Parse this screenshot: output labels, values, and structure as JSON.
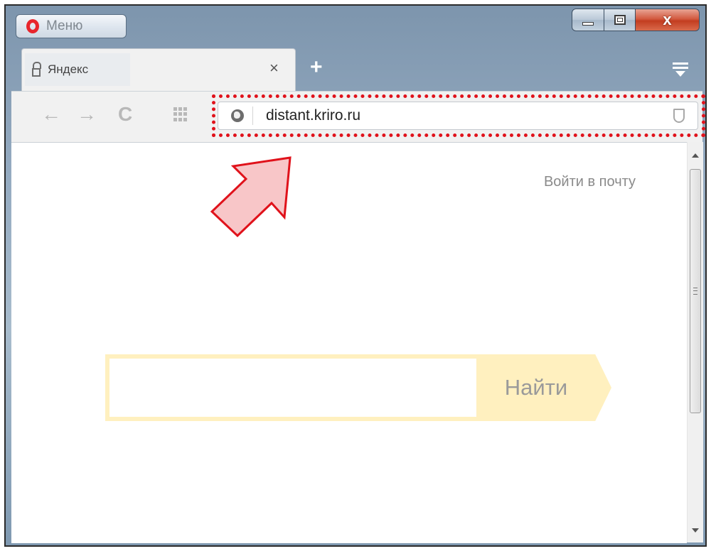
{
  "window": {
    "menu_label": "Меню",
    "close_symbol": "x",
    "colors": {
      "accent_red": "#e0121b",
      "yandex_yellow": "#fff0bf"
    }
  },
  "tab": {
    "title": "Яндекс",
    "close_symbol": "×",
    "icon": "lock-icon"
  },
  "tab_strip": {
    "new_tab_symbol": "+",
    "menu_icon": "tabs-menu-icon"
  },
  "toolbar": {
    "back_symbol": "←",
    "forward_symbol": "→",
    "reload_symbol": "C",
    "address_value": "distant.kriro.ru"
  },
  "page": {
    "login_link": "Войти в почту",
    "search_button": "Найти",
    "search_value": ""
  }
}
